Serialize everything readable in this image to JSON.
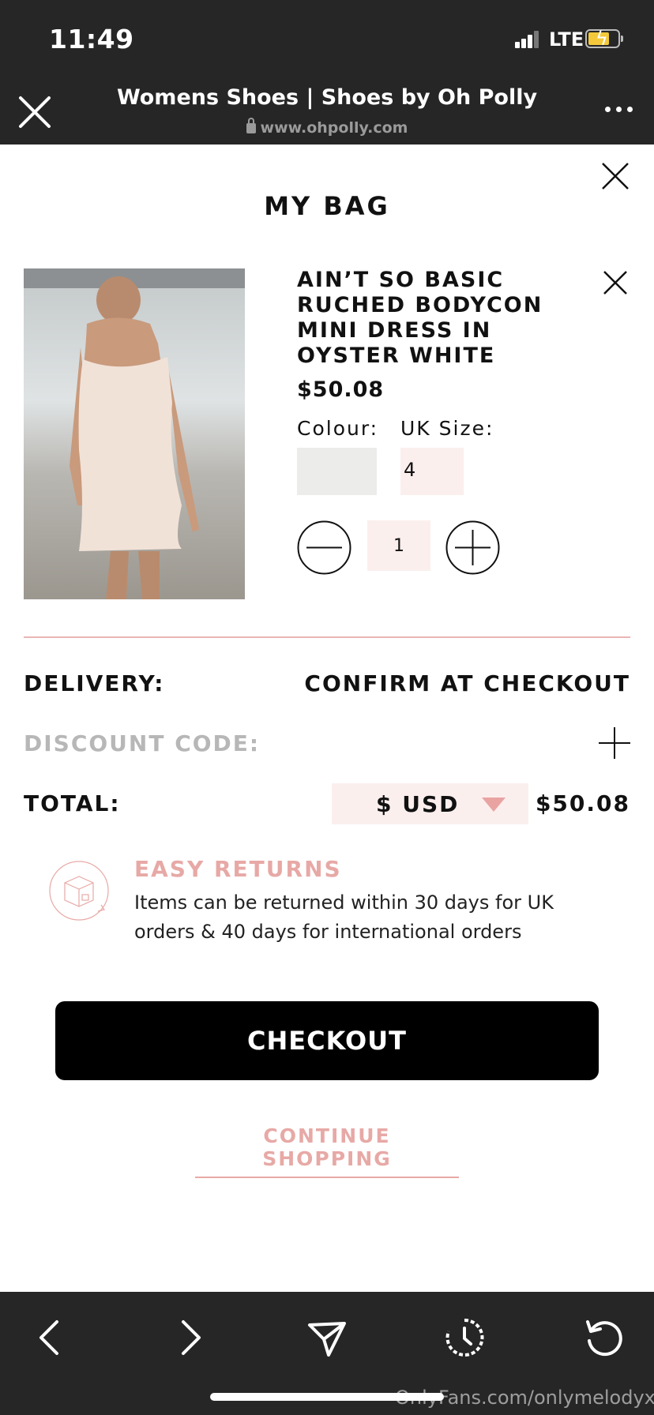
{
  "status_bar": {
    "time": "11:49",
    "network": "LTE"
  },
  "browser": {
    "title": "Womens Shoes | Shoes by Oh Polly",
    "url": "www.ohpolly.com"
  },
  "bag": {
    "title": "MY BAG",
    "item": {
      "name": "AIN’T SO BASIC RUCHED BODYCON MINI DRESS IN OYSTER WHITE",
      "price": "$50.08",
      "colour_label": "Colour:",
      "size_label": "UK Size:",
      "size_value": "4",
      "quantity": "1",
      "swatch_color": "#ececeb"
    },
    "delivery_label": "DELIVERY:",
    "delivery_value": "CONFIRM AT CHECKOUT",
    "discount_label": "DISCOUNT CODE:",
    "total_label": "TOTAL:",
    "currency": "$ USD",
    "total_value": "$50.08",
    "returns": {
      "title": "EASY RETURNS",
      "text": "Items can be returned within 30 days for UK orders & 40 days for international orders"
    },
    "checkout_label": "CHECKOUT",
    "continue_label": "CONTINUE SHOPPING"
  },
  "toolbar_icons": [
    "back-icon",
    "forward-icon",
    "share-icon",
    "history-icon",
    "reload-icon"
  ],
  "watermark": "OnlyFans.com/onlymelodyxx",
  "colors": {
    "accent_pink": "#e7a9a6",
    "pink_bg": "#fbefee",
    "dark_bar": "#262626"
  }
}
